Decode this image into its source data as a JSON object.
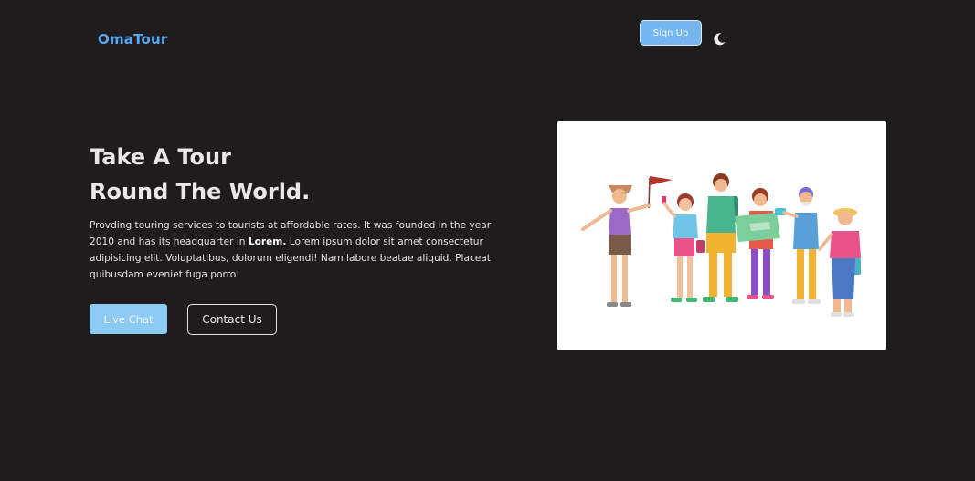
{
  "nav": {
    "logo": "OmaTour",
    "signup_label": "Sign Up",
    "theme_toggle_icon": "moon-icon"
  },
  "hero": {
    "title_line1": "Take A Tour",
    "title_line2": "Round The World.",
    "desc_before_bold": "Provding touring services to tourists at affordable rates. It was founded in the year 2010 and has its headquarter in ",
    "desc_bold": "Lorem.",
    "desc_after_bold": " Lorem ipsum dolor sit amet consectetur adipisicing elit. Voluptatibus, dolorum eligendi! Nam labore beatae aliquid. Placeat quibusdam eveniet fuga porro!",
    "live_chat_label": "Live Chat",
    "contact_label": "Contact Us"
  },
  "illustration": {
    "icon": "group-of-tourists-illustration"
  },
  "colors": {
    "background": "#1f1c1e",
    "accent": "#5aa7f0",
    "button_primary": "#8ccaf4",
    "signup_bg": "#74b6ef"
  }
}
